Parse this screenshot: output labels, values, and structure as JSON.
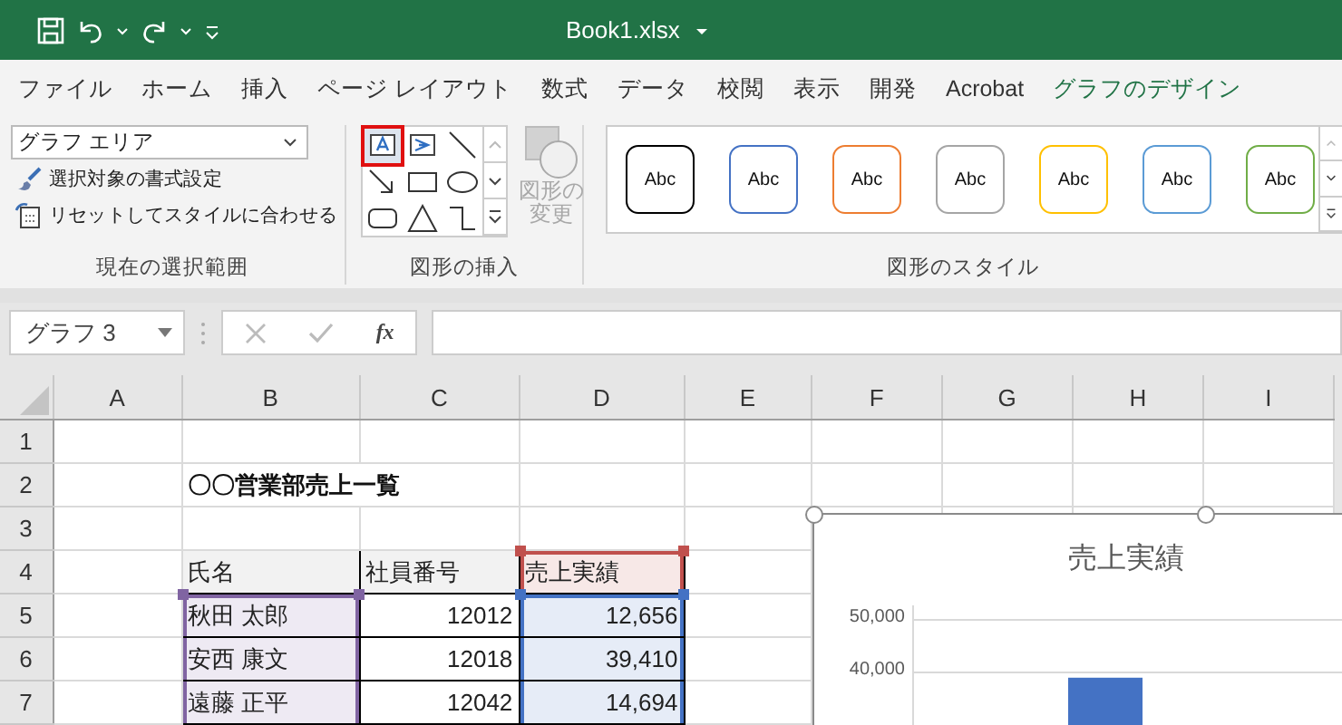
{
  "title_bar": {
    "title": "Book1.xlsx"
  },
  "tabs": [
    {
      "label": "ファイル",
      "selected": false,
      "kind": "normal"
    },
    {
      "label": "ホーム",
      "selected": false,
      "kind": "normal"
    },
    {
      "label": "挿入",
      "selected": false,
      "kind": "normal"
    },
    {
      "label": "ページ レイアウト",
      "selected": false,
      "kind": "normal"
    },
    {
      "label": "数式",
      "selected": false,
      "kind": "normal"
    },
    {
      "label": "データ",
      "selected": false,
      "kind": "normal"
    },
    {
      "label": "校閲",
      "selected": false,
      "kind": "normal"
    },
    {
      "label": "表示",
      "selected": false,
      "kind": "normal"
    },
    {
      "label": "開発",
      "selected": false,
      "kind": "normal"
    },
    {
      "label": "Acrobat",
      "selected": false,
      "kind": "normal"
    },
    {
      "label": "グラフのデザイン",
      "selected": false,
      "kind": "contextual"
    }
  ],
  "ribbon": {
    "groups": [
      {
        "kind": "selection",
        "label": "現在の選択範囲",
        "dropdown": "グラフ エリア",
        "buttons": [
          {
            "kind": "format",
            "label": "選択対象の書式設定"
          },
          {
            "kind": "reset",
            "label": "リセットしてスタイルに合わせる"
          }
        ]
      },
      {
        "kind": "shapes",
        "label": "図形の挿入",
        "shapes": [
          {
            "kind": "textbox",
            "selected": true
          },
          {
            "kind": "vertical_textbox",
            "selected": false
          },
          {
            "kind": "line",
            "selected": false
          },
          {
            "kind": "arrow",
            "selected": false
          },
          {
            "kind": "rectangle",
            "selected": false
          },
          {
            "kind": "oval",
            "selected": false
          },
          {
            "kind": "rounded_rectangle",
            "selected": false
          },
          {
            "kind": "triangle",
            "selected": false
          },
          {
            "kind": "connector",
            "selected": false
          }
        ],
        "change_shape": {
          "label": "図形の変更",
          "disabled": true
        }
      },
      {
        "kind": "styles",
        "label": "図形のスタイル",
        "styles": [
          {
            "label": "Abc",
            "color": "#000000"
          },
          {
            "label": "Abc",
            "color": "#4472c4"
          },
          {
            "label": "Abc",
            "color": "#ed7d31"
          },
          {
            "label": "Abc",
            "color": "#a5a5a5"
          },
          {
            "label": "Abc",
            "color": "#ffc000"
          },
          {
            "label": "Abc",
            "color": "#5b9bd5"
          },
          {
            "label": "Abc",
            "color": "#70ad47"
          }
        ]
      }
    ]
  },
  "formula_bar": {
    "name_box": "グラフ 3",
    "function_label": "fx"
  },
  "sheet": {
    "columns": [
      "A",
      "B",
      "C",
      "D",
      "E",
      "F",
      "G",
      "H",
      "I"
    ],
    "rows": [
      {
        "label": "1",
        "cells": []
      },
      {
        "label": "2",
        "cells": [
          "",
          {
            "text": "〇〇営業部売上一覧",
            "kind": "title",
            "colspan": 2
          }
        ]
      },
      {
        "label": "3",
        "cells": []
      },
      {
        "label": "4",
        "cells": [
          "",
          {
            "text": "氏名",
            "kind": "header"
          },
          {
            "text": "社員番号",
            "kind": "header"
          },
          {
            "text": "売上実績",
            "kind": "header",
            "color": "#c0504d"
          }
        ]
      },
      {
        "label": "5",
        "cells": [
          "",
          {
            "text": "秋田 太郎",
            "kind": "text",
            "color": "#8064a2"
          },
          {
            "text": "12012",
            "kind": "number"
          },
          {
            "text": "12,656",
            "kind": "number",
            "color": "#4472c4"
          }
        ]
      },
      {
        "label": "6",
        "cells": [
          "",
          {
            "text": "安西 康文",
            "kind": "text",
            "color": "#8064a2"
          },
          {
            "text": "12018",
            "kind": "number"
          },
          {
            "text": "39,410",
            "kind": "number",
            "color": "#4472c4"
          }
        ]
      },
      {
        "label": "7",
        "cells": [
          "",
          {
            "text": "遠藤 正平",
            "kind": "text",
            "color": "#8064a2"
          },
          {
            "text": "12042",
            "kind": "number"
          },
          {
            "text": "14,694",
            "kind": "number",
            "color": "#4472c4"
          }
        ]
      }
    ],
    "chart": {
      "chart_data": {
        "type": "bar",
        "title": "売上実績",
        "values": [
          39000
        ],
        "ylim": [
          30000,
          50000
        ],
        "yticks": [
          {
            "value": 40000,
            "label": "40,000"
          },
          {
            "value": 50000,
            "label": "50,000"
          }
        ]
      }
    }
  }
}
